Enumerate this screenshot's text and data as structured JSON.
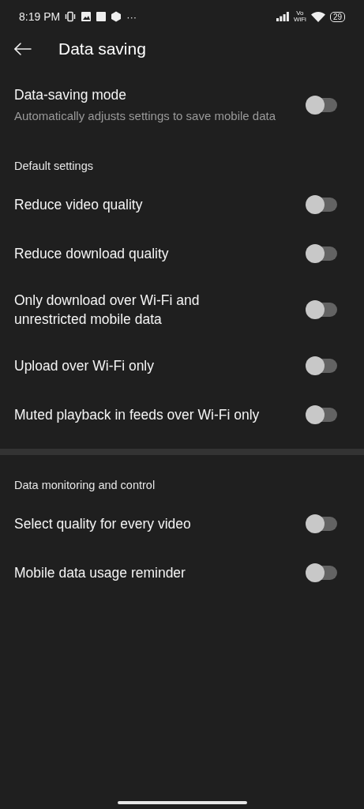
{
  "status_bar": {
    "time": "8:19 PM",
    "more": "···",
    "vowifi_top": "Vo",
    "vowifi_bottom": "WiFi",
    "battery": "29"
  },
  "header": {
    "title": "Data saving"
  },
  "sections": [
    {
      "items": [
        {
          "title": "Data-saving mode",
          "subtitle": "Automatically adjusts settings to save mobile data",
          "on": false
        }
      ]
    },
    {
      "title": "Default settings",
      "items": [
        {
          "title": "Reduce video quality",
          "on": false
        },
        {
          "title": "Reduce download quality",
          "on": false
        },
        {
          "title": "Only download over Wi-Fi and unrestricted mobile data",
          "on": false
        },
        {
          "title": "Upload over Wi-Fi only",
          "on": false
        },
        {
          "title": "Muted playback in feeds over Wi-Fi only",
          "on": false
        }
      ]
    },
    {
      "title": "Data monitoring and control",
      "items": [
        {
          "title": "Select quality for every video",
          "on": false
        },
        {
          "title": "Mobile data usage reminder",
          "on": false
        }
      ]
    }
  ]
}
